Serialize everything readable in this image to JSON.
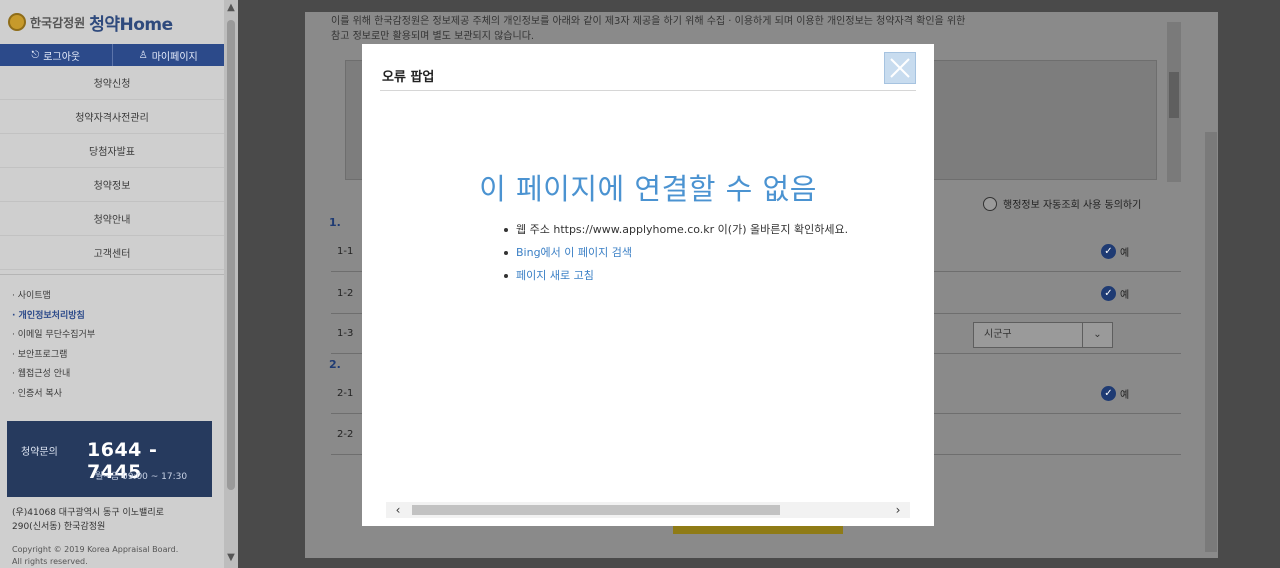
{
  "sidebar": {
    "org_name": "한국감정원",
    "brand": "청약Home",
    "auth": [
      {
        "label": "로그아웃",
        "icon": "logout-icon"
      },
      {
        "label": "마이페이지",
        "icon": "user-icon"
      }
    ],
    "nav": [
      {
        "label": "청약신청"
      },
      {
        "label": "청약자격사전관리"
      },
      {
        "label": "당첨자발표"
      },
      {
        "label": "청약정보"
      },
      {
        "label": "청약안내"
      },
      {
        "label": "고객센터"
      }
    ],
    "links": [
      {
        "label": "· 사이트맵"
      },
      {
        "label": "· 개인정보처리방침"
      },
      {
        "label": "· 이메일 무단수집거부"
      },
      {
        "label": "· 보안프로그램"
      },
      {
        "label": "· 웹접근성 안내"
      },
      {
        "label": "· 인증서 복사"
      }
    ],
    "call": {
      "title": "청약문의",
      "phone": "1644 - 7445",
      "hours": "월~금 09:00 ~ 17:30"
    },
    "address_line1": "(우)41068 대구광역시 동구 이노밸리로",
    "address_line2": "290(신서동) 한국감정원",
    "copyright_line1": "Copyright © 2019 Korea Appraisal Board.",
    "copyright_line2": "All rights reserved."
  },
  "background": {
    "intro_text": "이를 위해 한국감정원은 정보제공 주체의 개인정보를 아래와 같이 제3자 제공을 하기 위해 수집 · 이용하게 되며 이용한 개인정보는 청약자격 확인을 위한",
    "intro_text2": "참고 정보로만 활용되며 별도 보관되지 않습니다.",
    "agree_label": "행정정보 자동조회 사용 동의하기",
    "section1": "1.",
    "section2": "2.",
    "rows": [
      {
        "num": "1-1",
        "check": "예"
      },
      {
        "num": "1-2",
        "check": "예"
      },
      {
        "num": "1-3",
        "select": "시군구"
      },
      {
        "num": "2-1",
        "check": "예"
      },
      {
        "num": "2-2"
      }
    ]
  },
  "modal": {
    "title": "오류 팝업",
    "error_title": "이 페이지에 연결할 수 없음",
    "items": [
      {
        "text": "웹 주소 https://www.applyhome.co.kr 이(가) 올바른지 확인하세요.",
        "link": false
      },
      {
        "text": "Bing에서 이 페이지 검색",
        "link": true
      },
      {
        "text": "페이지 새로 고침",
        "link": true
      }
    ]
  }
}
